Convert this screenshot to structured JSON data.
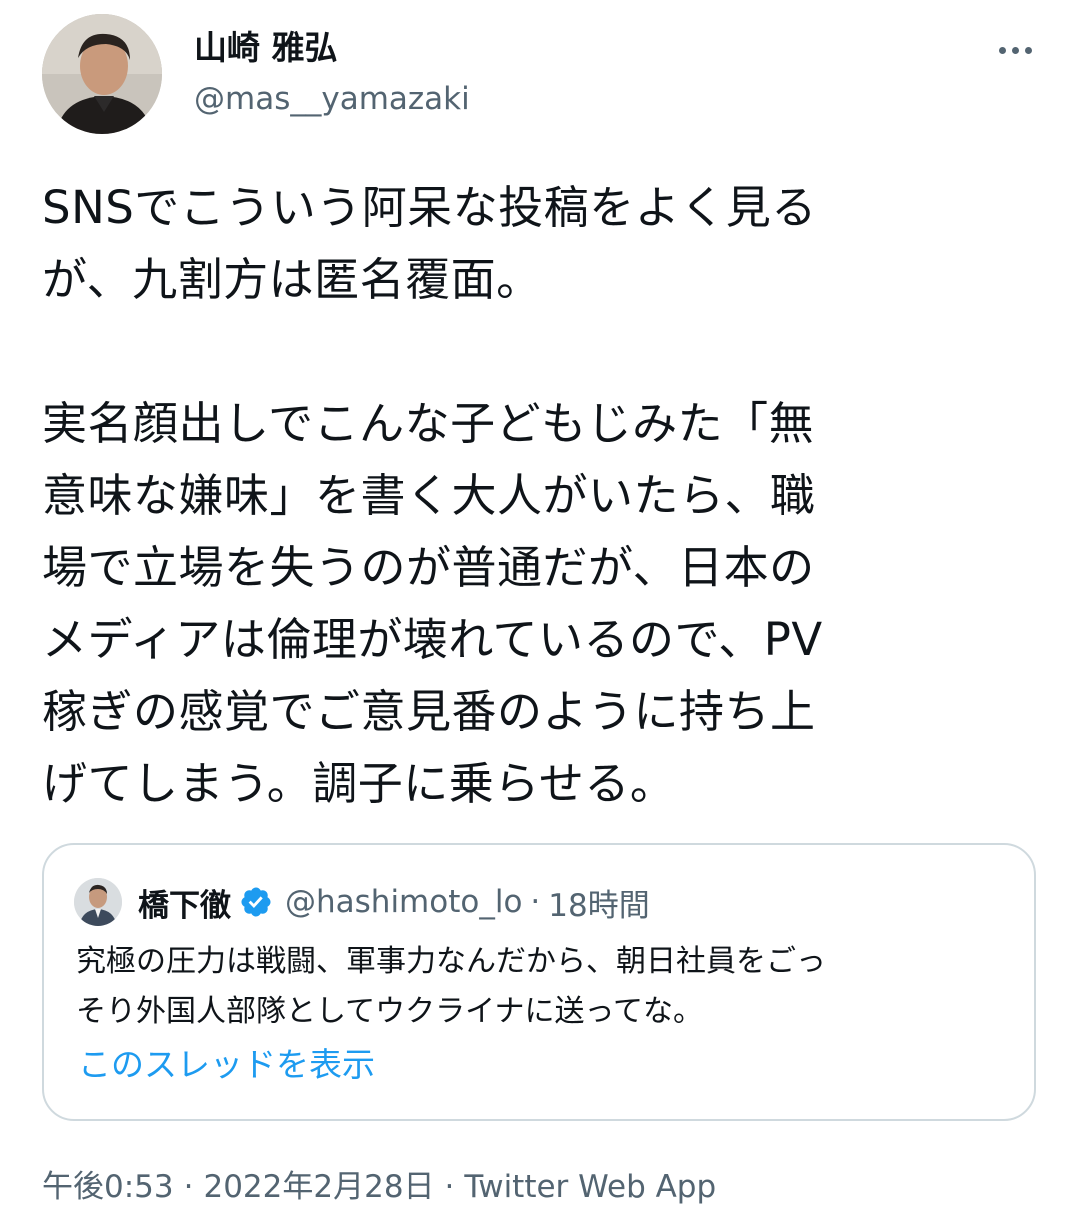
{
  "author": {
    "display_name": "山崎 雅弘",
    "handle": "@mas__yamazaki"
  },
  "tweet": {
    "text": "SNSでこういう阿呆な投稿をよく見る\nが、九割方は匿名覆面。\n\n実名顔出しでこんな子どもじみた「無\n意味な嫌味」を書く大人がいたら、職\n場で立場を失うのが普通だが、日本の\nメディアは倫理が壊れているので、PV\n稼ぎの感覚でご意見番のように持ち上\nげてしまう。調子に乗らせる。"
  },
  "quoted_tweet": {
    "display_name": "橋下徹",
    "verified_icon": "verified-badge-icon",
    "handle": "@hashimoto_lo",
    "separator": "·",
    "time": "18時間",
    "text": "究極の圧力は戦闘、軍事力なんだから、朝日社員をごっ\nそり外国人部隊としてウクライナに送ってな。",
    "show_thread_label": "このスレッドを表示"
  },
  "meta": {
    "time": "午後0:53",
    "separator": "·",
    "date": "2022年2月28日",
    "source": "Twitter Web App"
  },
  "colors": {
    "text_primary": "#0f1419",
    "text_secondary": "#536471",
    "link": "#1d9bf0",
    "border": "#cfd9de",
    "verified": "#1d9bf0"
  },
  "icons": {
    "more": "more-dots-icon"
  }
}
